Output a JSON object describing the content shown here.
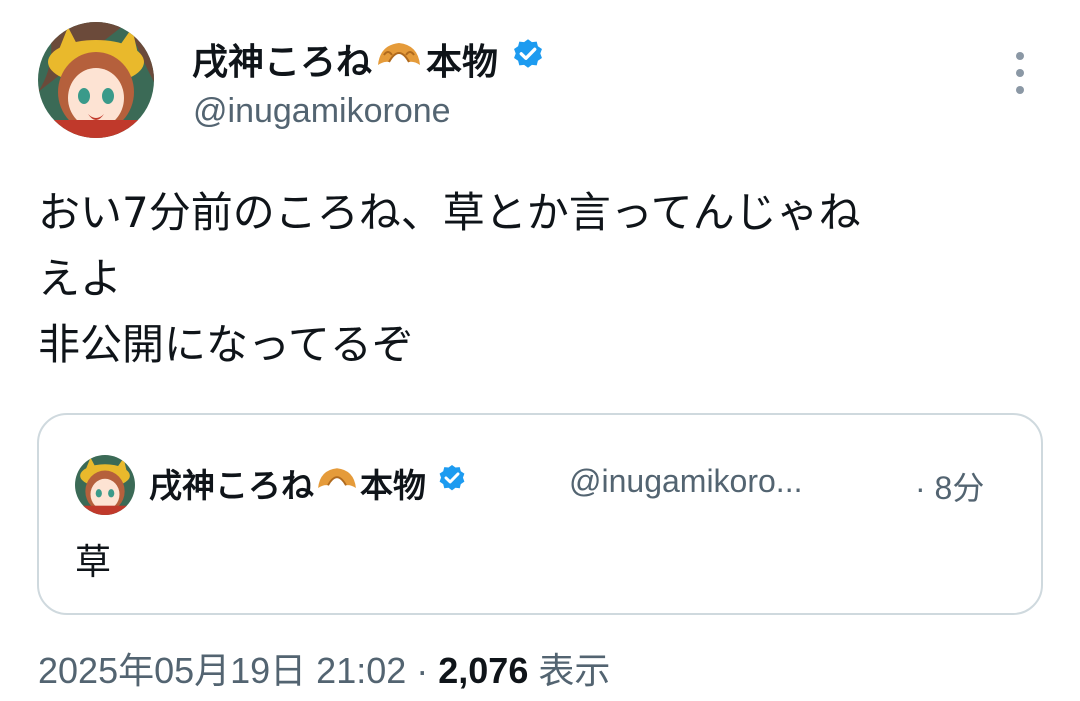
{
  "author": {
    "display_name": "戌神ころね",
    "display_name_suffix": "本物",
    "emoji_icon": "croissant-icon",
    "verified_icon": "verified-badge-icon",
    "handle": "@inugamikorone"
  },
  "tweet": {
    "text": "おい7分前のころね、草とか言ってんじゃね\nえよ\n非公開になってるぞ"
  },
  "quoted_tweet": {
    "display_name": "戌神ころね",
    "display_name_suffix": "本物",
    "handle": "@inugamikoro...",
    "time": "· 8分",
    "text": "草"
  },
  "meta": {
    "timestamp": "2025年05月19日 21:02",
    "separator": " · ",
    "views_count": "2,076",
    "views_label": " 表示"
  },
  "colors": {
    "text": "#0f1419",
    "secondary": "#536471",
    "verified_blue": "#1d9bf0",
    "border": "#cfd9de"
  }
}
